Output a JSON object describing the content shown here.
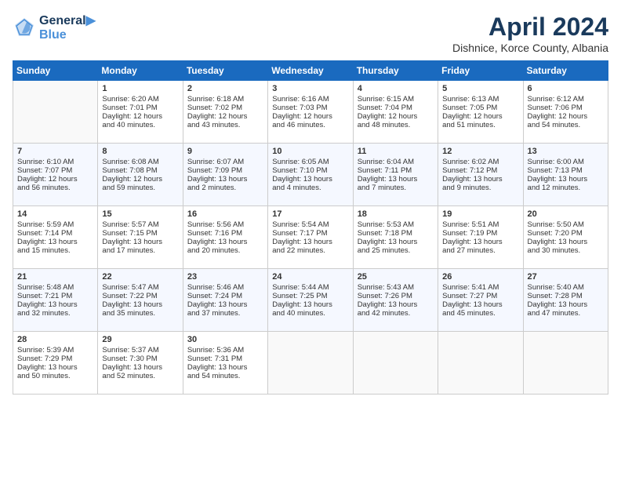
{
  "header": {
    "logo_line1": "General",
    "logo_line2": "Blue",
    "month": "April 2024",
    "location": "Dishnice, Korce County, Albania"
  },
  "weekdays": [
    "Sunday",
    "Monday",
    "Tuesday",
    "Wednesday",
    "Thursday",
    "Friday",
    "Saturday"
  ],
  "weeks": [
    [
      {
        "day": "",
        "info": ""
      },
      {
        "day": "1",
        "info": "Sunrise: 6:20 AM\nSunset: 7:01 PM\nDaylight: 12 hours\nand 40 minutes."
      },
      {
        "day": "2",
        "info": "Sunrise: 6:18 AM\nSunset: 7:02 PM\nDaylight: 12 hours\nand 43 minutes."
      },
      {
        "day": "3",
        "info": "Sunrise: 6:16 AM\nSunset: 7:03 PM\nDaylight: 12 hours\nand 46 minutes."
      },
      {
        "day": "4",
        "info": "Sunrise: 6:15 AM\nSunset: 7:04 PM\nDaylight: 12 hours\nand 48 minutes."
      },
      {
        "day": "5",
        "info": "Sunrise: 6:13 AM\nSunset: 7:05 PM\nDaylight: 12 hours\nand 51 minutes."
      },
      {
        "day": "6",
        "info": "Sunrise: 6:12 AM\nSunset: 7:06 PM\nDaylight: 12 hours\nand 54 minutes."
      }
    ],
    [
      {
        "day": "7",
        "info": "Sunrise: 6:10 AM\nSunset: 7:07 PM\nDaylight: 12 hours\nand 56 minutes."
      },
      {
        "day": "8",
        "info": "Sunrise: 6:08 AM\nSunset: 7:08 PM\nDaylight: 12 hours\nand 59 minutes."
      },
      {
        "day": "9",
        "info": "Sunrise: 6:07 AM\nSunset: 7:09 PM\nDaylight: 13 hours\nand 2 minutes."
      },
      {
        "day": "10",
        "info": "Sunrise: 6:05 AM\nSunset: 7:10 PM\nDaylight: 13 hours\nand 4 minutes."
      },
      {
        "day": "11",
        "info": "Sunrise: 6:04 AM\nSunset: 7:11 PM\nDaylight: 13 hours\nand 7 minutes."
      },
      {
        "day": "12",
        "info": "Sunrise: 6:02 AM\nSunset: 7:12 PM\nDaylight: 13 hours\nand 9 minutes."
      },
      {
        "day": "13",
        "info": "Sunrise: 6:00 AM\nSunset: 7:13 PM\nDaylight: 13 hours\nand 12 minutes."
      }
    ],
    [
      {
        "day": "14",
        "info": "Sunrise: 5:59 AM\nSunset: 7:14 PM\nDaylight: 13 hours\nand 15 minutes."
      },
      {
        "day": "15",
        "info": "Sunrise: 5:57 AM\nSunset: 7:15 PM\nDaylight: 13 hours\nand 17 minutes."
      },
      {
        "day": "16",
        "info": "Sunrise: 5:56 AM\nSunset: 7:16 PM\nDaylight: 13 hours\nand 20 minutes."
      },
      {
        "day": "17",
        "info": "Sunrise: 5:54 AM\nSunset: 7:17 PM\nDaylight: 13 hours\nand 22 minutes."
      },
      {
        "day": "18",
        "info": "Sunrise: 5:53 AM\nSunset: 7:18 PM\nDaylight: 13 hours\nand 25 minutes."
      },
      {
        "day": "19",
        "info": "Sunrise: 5:51 AM\nSunset: 7:19 PM\nDaylight: 13 hours\nand 27 minutes."
      },
      {
        "day": "20",
        "info": "Sunrise: 5:50 AM\nSunset: 7:20 PM\nDaylight: 13 hours\nand 30 minutes."
      }
    ],
    [
      {
        "day": "21",
        "info": "Sunrise: 5:48 AM\nSunset: 7:21 PM\nDaylight: 13 hours\nand 32 minutes."
      },
      {
        "day": "22",
        "info": "Sunrise: 5:47 AM\nSunset: 7:22 PM\nDaylight: 13 hours\nand 35 minutes."
      },
      {
        "day": "23",
        "info": "Sunrise: 5:46 AM\nSunset: 7:24 PM\nDaylight: 13 hours\nand 37 minutes."
      },
      {
        "day": "24",
        "info": "Sunrise: 5:44 AM\nSunset: 7:25 PM\nDaylight: 13 hours\nand 40 minutes."
      },
      {
        "day": "25",
        "info": "Sunrise: 5:43 AM\nSunset: 7:26 PM\nDaylight: 13 hours\nand 42 minutes."
      },
      {
        "day": "26",
        "info": "Sunrise: 5:41 AM\nSunset: 7:27 PM\nDaylight: 13 hours\nand 45 minutes."
      },
      {
        "day": "27",
        "info": "Sunrise: 5:40 AM\nSunset: 7:28 PM\nDaylight: 13 hours\nand 47 minutes."
      }
    ],
    [
      {
        "day": "28",
        "info": "Sunrise: 5:39 AM\nSunset: 7:29 PM\nDaylight: 13 hours\nand 50 minutes."
      },
      {
        "day": "29",
        "info": "Sunrise: 5:37 AM\nSunset: 7:30 PM\nDaylight: 13 hours\nand 52 minutes."
      },
      {
        "day": "30",
        "info": "Sunrise: 5:36 AM\nSunset: 7:31 PM\nDaylight: 13 hours\nand 54 minutes."
      },
      {
        "day": "",
        "info": ""
      },
      {
        "day": "",
        "info": ""
      },
      {
        "day": "",
        "info": ""
      },
      {
        "day": "",
        "info": ""
      }
    ]
  ]
}
